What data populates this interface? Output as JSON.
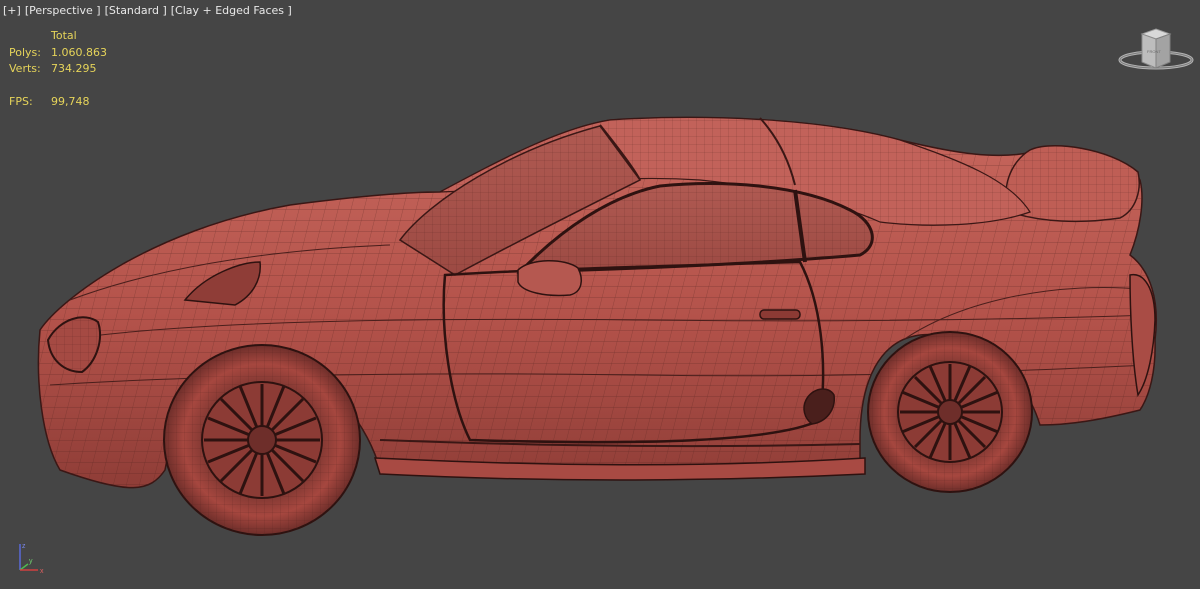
{
  "viewport": {
    "labels": {
      "menu": "[+]",
      "view": "[Perspective ]",
      "shading_standard": "[Standard ]",
      "shading_mode": "[Clay + Edged Faces ]"
    },
    "stats": {
      "header": "Total",
      "polys_label": "Polys:",
      "polys_value": "1.060.863",
      "verts_label": "Verts:",
      "verts_value": "734.295",
      "fps_label": "FPS:",
      "fps_value": "99,748"
    },
    "viewcube": {
      "face_label": "FRONT"
    },
    "gizmo": {
      "axes": [
        "x",
        "y",
        "z"
      ]
    }
  },
  "colors": {
    "background": "#454545",
    "clay": "#b8554c",
    "wire": "#4a1f1c",
    "stats_text": "#e6d45a",
    "label_text": "#e8e8e8"
  }
}
